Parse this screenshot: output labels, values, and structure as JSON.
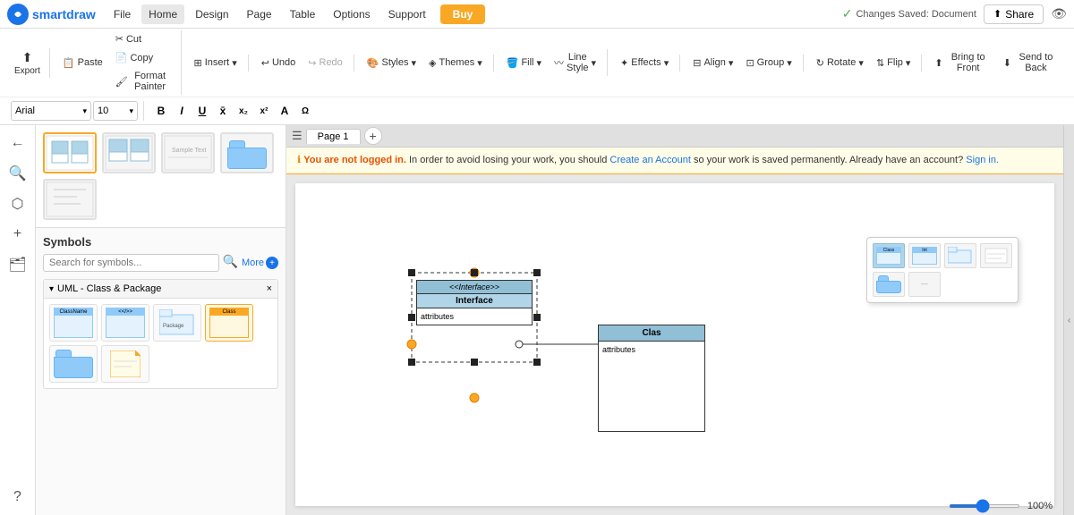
{
  "app": {
    "name_bold": "smart",
    "name_regular": "draw",
    "logo_letter": "S"
  },
  "menu": {
    "items": [
      "File",
      "Home",
      "Design",
      "Page",
      "Table",
      "Options",
      "Support"
    ],
    "active": "Home",
    "buy_label": "Buy"
  },
  "header": {
    "changes_saved": "Changes Saved: Document",
    "share_label": "Share"
  },
  "ribbon": {
    "row1": {
      "export_label": "Export",
      "paste_label": "Paste",
      "cut_label": "Cut",
      "copy_label": "Copy",
      "format_painter_label": "Format Painter",
      "insert_label": "Insert",
      "undo_label": "Undo",
      "redo_label": "Redo",
      "styles_label": "Styles",
      "themes_label": "Themes",
      "fill_label": "Fill",
      "line_style_label": "Line Style",
      "effects_label": "Effects",
      "align_label": "Align",
      "group_label": "Group",
      "rotate_label": "Rotate",
      "flip_label": "Flip",
      "bring_to_front_label": "Bring to Front",
      "send_to_back_label": "Send to Back"
    },
    "row2": {
      "font": "Arial",
      "font_size": "10",
      "bold": "B",
      "italic": "I",
      "underline": "U",
      "strikethrough": "S"
    }
  },
  "canvas_tab": {
    "page_label": "Page 1"
  },
  "warning": {
    "icon": "ℹ",
    "text1": "You are not logged in.",
    "text2": " In order to avoid losing your work, you should ",
    "create_account": "Create an Account",
    "text3": " so your work is saved permanently. Already have an account?",
    "sign_in": "Sign in."
  },
  "symbols_panel": {
    "title": "Symbols",
    "search_placeholder": "Search for symbols...",
    "more_label": "More",
    "category_name": "UML - Class & Package"
  },
  "diagram": {
    "interface_stereotype": "<<Interface>>",
    "interface_name": "Interface",
    "interface_attrs": "attributes",
    "class_name": "Clas",
    "class_attrs": "attributes"
  },
  "zoom": {
    "value": "100",
    "percent_label": "100%"
  },
  "icons": {
    "check_circle": "✓",
    "share_icon": "↑",
    "eye_icon": "👁",
    "search_icon": "🔍",
    "more_plus": "+",
    "list_icon": "☰",
    "add_icon": "+",
    "back_arrow": "←",
    "chevron_right": "›",
    "collapse": "‹",
    "undo_icon": "↩",
    "redo_icon": "↪",
    "close_icon": "×",
    "down_arrow": "▾"
  }
}
